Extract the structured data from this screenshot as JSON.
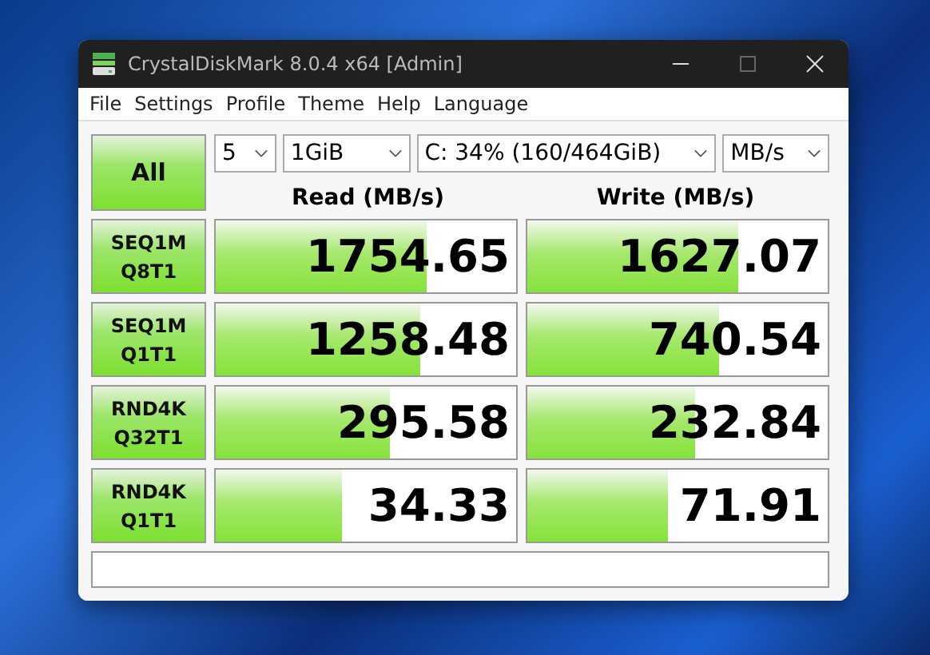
{
  "window": {
    "title": "CrystalDiskMark 8.0.4 x64 [Admin]"
  },
  "menu": [
    "File",
    "Settings",
    "Profile",
    "Theme",
    "Help",
    "Language"
  ],
  "all_button": "All",
  "selects": [
    {
      "value": "5"
    },
    {
      "value": "1GiB"
    },
    {
      "value": "C: 34% (160/464GiB)"
    },
    {
      "value": "MB/s"
    }
  ],
  "columns": [
    "Read (MB/s)",
    "Write (MB/s)"
  ],
  "rows": [
    {
      "test": "SEQ1M",
      "params": "Q8T1",
      "read": {
        "value": "1754.65",
        "level": 0.7
      },
      "write": {
        "value": "1627.07",
        "level": 0.7
      }
    },
    {
      "test": "SEQ1M",
      "params": "Q1T1",
      "read": {
        "value": "1258.48",
        "level": 0.68
      },
      "write": {
        "value": "740.54",
        "level": 0.64
      }
    },
    {
      "test": "RND4K",
      "params": "Q32T1",
      "read": {
        "value": "295.58",
        "level": 0.58
      },
      "write": {
        "value": "232.84",
        "level": 0.56
      }
    },
    {
      "test": "RND4K",
      "params": "Q1T1",
      "read": {
        "value": "34.33",
        "level": 0.42
      },
      "write": {
        "value": "71.91",
        "level": 0.47
      }
    }
  ]
}
